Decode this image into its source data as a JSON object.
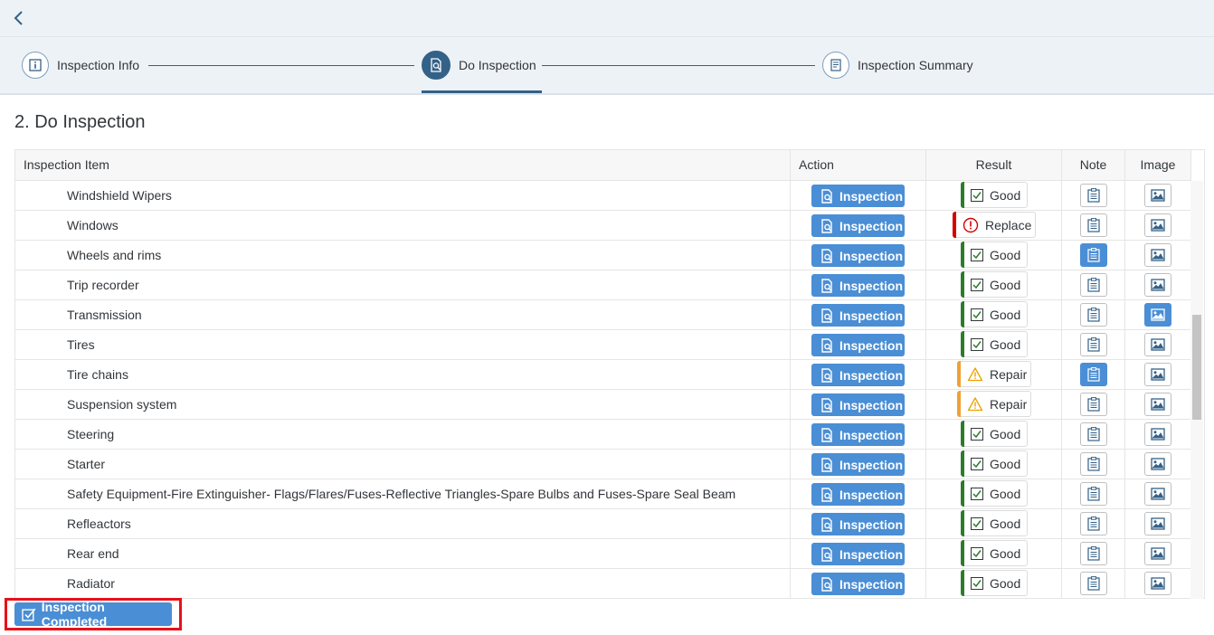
{
  "wizard": {
    "steps": [
      {
        "label": "Inspection Info",
        "icon": "info-icon",
        "active": false
      },
      {
        "label": "Do Inspection",
        "icon": "inspect-doc-icon",
        "active": true
      },
      {
        "label": "Inspection Summary",
        "icon": "summary-doc-icon",
        "active": false
      }
    ]
  },
  "page": {
    "title": "2. Do Inspection"
  },
  "table": {
    "columns": {
      "item": "Inspection Item",
      "action": "Action",
      "result": "Result",
      "note": "Note",
      "image": "Image"
    },
    "rows": [
      {
        "item": "Windshield Wipers",
        "action": "Inspection",
        "result": "Good",
        "status": "good",
        "note_on": false,
        "image_on": false
      },
      {
        "item": "Windows",
        "action": "Inspection",
        "result": "Replace",
        "status": "replace",
        "note_on": false,
        "image_on": false
      },
      {
        "item": "Wheels and rims",
        "action": "Inspection",
        "result": "Good",
        "status": "good",
        "note_on": true,
        "image_on": false
      },
      {
        "item": "Trip recorder",
        "action": "Inspection",
        "result": "Good",
        "status": "good",
        "note_on": false,
        "image_on": false
      },
      {
        "item": "Transmission",
        "action": "Inspection",
        "result": "Good",
        "status": "good",
        "note_on": false,
        "image_on": true
      },
      {
        "item": "Tires",
        "action": "Inspection",
        "result": "Good",
        "status": "good",
        "note_on": false,
        "image_on": false
      },
      {
        "item": "Tire chains",
        "action": "Inspection",
        "result": "Repair",
        "status": "repair",
        "note_on": true,
        "image_on": false
      },
      {
        "item": "Suspension system",
        "action": "Inspection",
        "result": "Repair",
        "status": "repair",
        "note_on": false,
        "image_on": false
      },
      {
        "item": "Steering",
        "action": "Inspection",
        "result": "Good",
        "status": "good",
        "note_on": false,
        "image_on": false
      },
      {
        "item": "Starter",
        "action": "Inspection",
        "result": "Good",
        "status": "good",
        "note_on": false,
        "image_on": false
      },
      {
        "item": "Safety Equipment-Fire Extinguisher- Flags/Flares/Fuses-Reflective Triangles-Spare Bulbs and Fuses-Spare Seal Beam",
        "action": "Inspection",
        "result": "Good",
        "status": "good",
        "note_on": false,
        "image_on": false
      },
      {
        "item": "Refleactors",
        "action": "Inspection",
        "result": "Good",
        "status": "good",
        "note_on": false,
        "image_on": false
      },
      {
        "item": "Rear end",
        "action": "Inspection",
        "result": "Good",
        "status": "good",
        "note_on": false,
        "image_on": false
      },
      {
        "item": "Radiator",
        "action": "Inspection",
        "result": "Good",
        "status": "good",
        "note_on": false,
        "image_on": false
      }
    ]
  },
  "footer": {
    "complete_label": "Inspection Completed"
  },
  "colors": {
    "accent": "#4a8ed5",
    "wizard_active": "#346187",
    "good": "#2b7c2b",
    "replace": "#d40000",
    "repair": "#f0a034",
    "highlight": "#e8101b"
  }
}
